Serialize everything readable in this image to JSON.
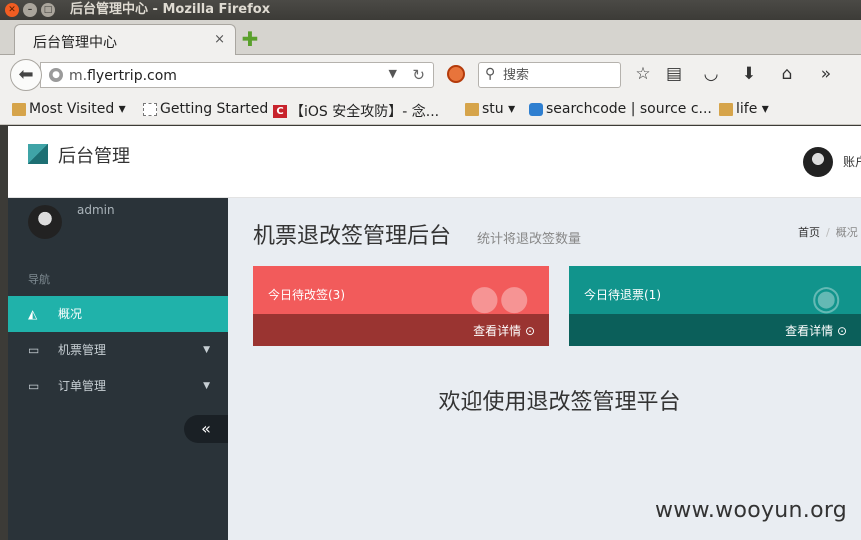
{
  "window": {
    "title": "后台管理中心 - Mozilla Firefox"
  },
  "tab": {
    "title": "后台管理中心",
    "close": "×"
  },
  "nav": {
    "url_domain": "m.",
    "url_host": "flyertrip.com",
    "search_placeholder": "搜索"
  },
  "bookmarks": [
    {
      "label": "Most Visited ▾"
    },
    {
      "label": "Getting Started"
    },
    {
      "label": "【iOS 安全攻防】- 念..."
    },
    {
      "label": "stu ▾"
    },
    {
      "label": "searchcode | source c..."
    },
    {
      "label": "life ▾"
    }
  ],
  "header": {
    "brand": "后台管理",
    "account": "账户"
  },
  "sidebar": {
    "user": "admin",
    "nav_label": "导航",
    "items": [
      {
        "label": "概况",
        "icon": "area-chart-icon"
      },
      {
        "label": "机票管理",
        "icon": "laptop-icon"
      },
      {
        "label": "订单管理",
        "icon": "laptop-icon"
      }
    ],
    "collapse": "«"
  },
  "content": {
    "title": "机票退改签管理后台",
    "subtitle": "统计将退改签数量",
    "breadcrumb": {
      "home": "首页",
      "current": "概况"
    },
    "cards": [
      {
        "label": "今日待改签(3)",
        "more": "查看详情 ⊙",
        "color": "#f25b5b"
      },
      {
        "label": "今日待退票(1)",
        "more": "查看详情 ⊙",
        "color": "#11948c"
      }
    ],
    "welcome": "欢迎使用退改签管理平台"
  },
  "watermark": "www.wooyun.org"
}
